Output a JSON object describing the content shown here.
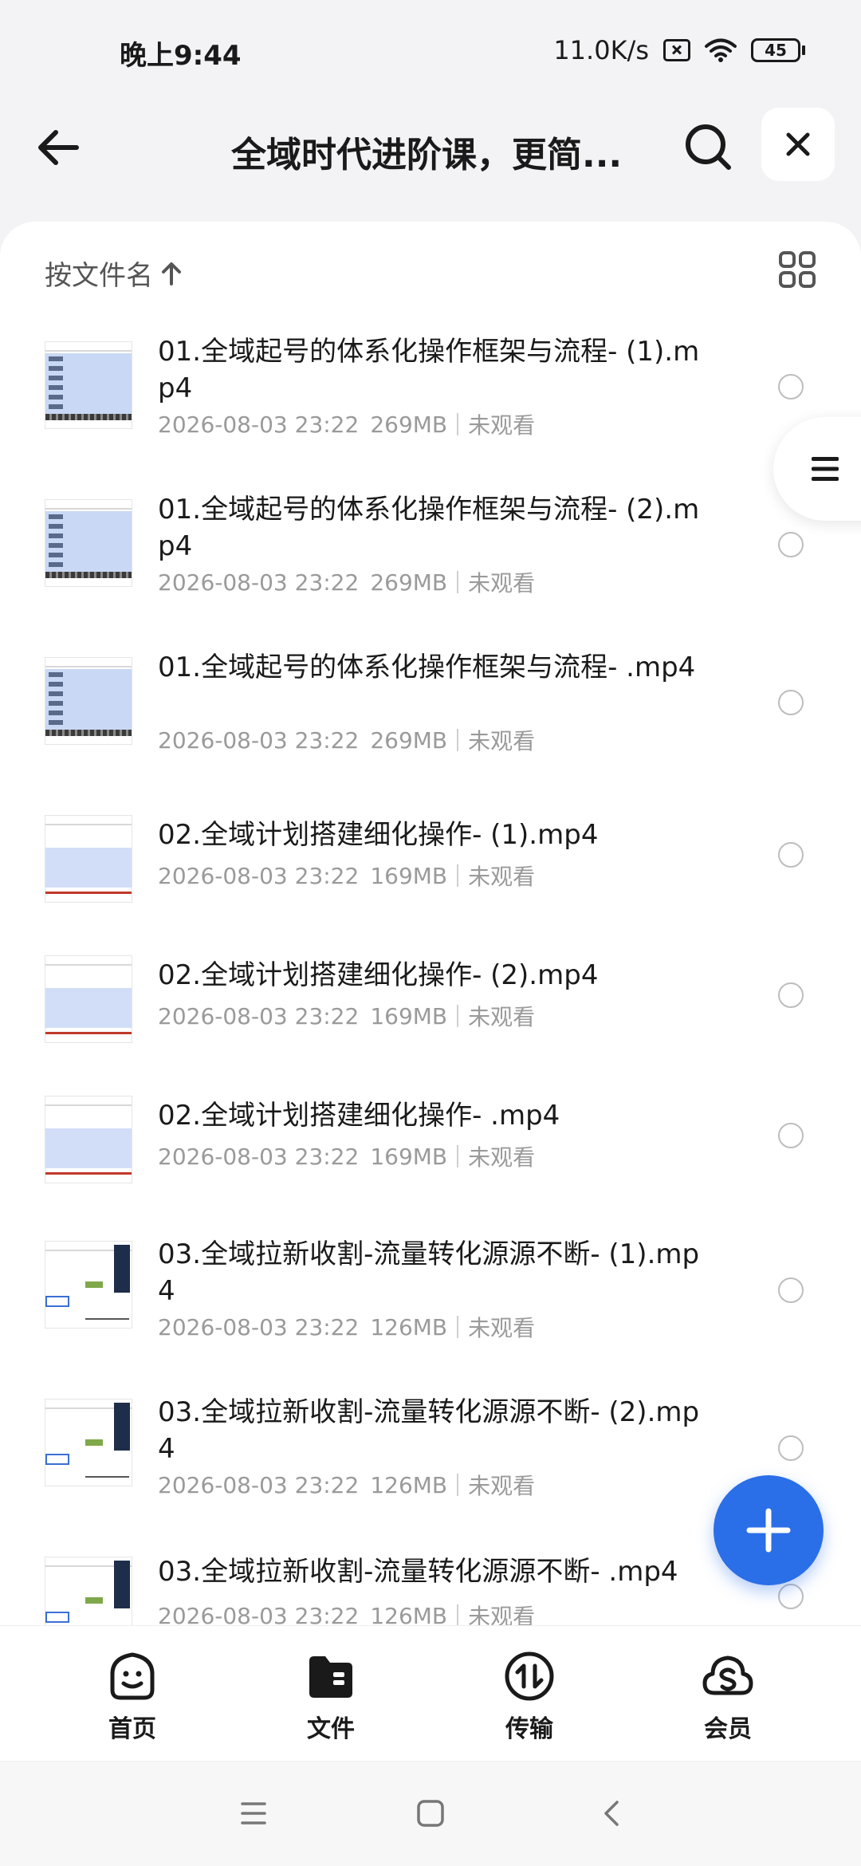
{
  "status_bar": {
    "time": "晚上9:44",
    "net_speed": "11.0K/s",
    "battery": "45"
  },
  "header": {
    "title": "全域时代进阶课，更简..."
  },
  "sort": {
    "label": "按文件名"
  },
  "files": [
    {
      "name": "01.全域起号的体系化操作框架与流程- (1).mp4",
      "date": "2026-08-03 23:22",
      "size": "269MB",
      "status": "未观看"
    },
    {
      "name": "01.全域起号的体系化操作框架与流程- (2).mp4",
      "date": "2026-08-03 23:22",
      "size": "269MB",
      "status": "未观看"
    },
    {
      "name": "01.全域起号的体系化操作框架与流程- .mp4",
      "date": "2026-08-03 23:22",
      "size": "269MB",
      "status": "未观看"
    },
    {
      "name": "02.全域计划搭建细化操作- (1).mp4",
      "date": "2026-08-03 23:22",
      "size": "169MB",
      "status": "未观看"
    },
    {
      "name": "02.全域计划搭建细化操作- (2).mp4",
      "date": "2026-08-03 23:22",
      "size": "169MB",
      "status": "未观看"
    },
    {
      "name": "02.全域计划搭建细化操作- .mp4",
      "date": "2026-08-03 23:22",
      "size": "169MB",
      "status": "未观看"
    },
    {
      "name": "03.全域拉新收割-流量转化源源不断- (1).mp4",
      "date": "2026-08-03 23:22",
      "size": "126MB",
      "status": "未观看"
    },
    {
      "name": "03.全域拉新收割-流量转化源源不断- (2).mp4",
      "date": "2026-08-03 23:22",
      "size": "126MB",
      "status": "未观看"
    },
    {
      "name": "03.全域拉新收割-流量转化源源不断- .mp4",
      "date": "2026-08-03 23:22",
      "size": "126MB",
      "status": "未观看"
    }
  ],
  "bottom_nav": {
    "items": [
      {
        "label": "首页"
      },
      {
        "label": "文件"
      },
      {
        "label": "传输"
      },
      {
        "label": "会员"
      }
    ]
  },
  "colors": {
    "accent": "#2a6ee8",
    "background": "#f3f3f5",
    "card": "#ffffff",
    "meta_text": "#9a9a9a"
  }
}
